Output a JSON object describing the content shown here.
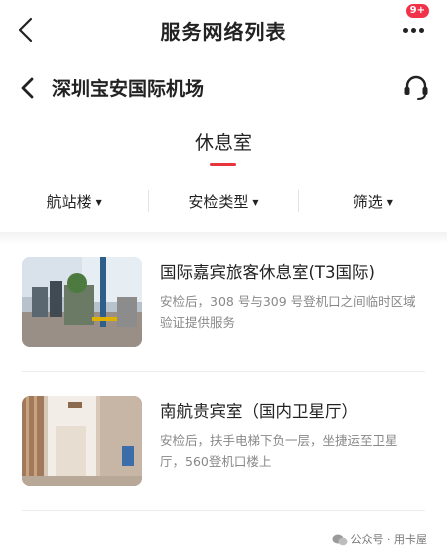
{
  "header": {
    "title": "服务网络列表",
    "badge": "9+"
  },
  "subheader": {
    "airport": "深圳宝安国际机场"
  },
  "tab": {
    "label": "休息室"
  },
  "filters": {
    "terminal": "航站楼",
    "security_type": "安检类型",
    "filter": "筛选"
  },
  "lounges": [
    {
      "title": "国际嘉宾旅客休息室(T3国际)",
      "desc": "安检后，308 号与309 号登机口之间临时区域验证提供服务"
    },
    {
      "title": "南航贵宾室（国内卫星厅）",
      "desc": "安检后，扶手电梯下负一层，坐捷运至卫星厅，560登机口楼上"
    }
  ],
  "watermark": {
    "text": "公众号 · 用卡屋"
  },
  "colors": {
    "accent": "#e8343d",
    "badge": "#f0334a",
    "muted_text": "#888888"
  }
}
